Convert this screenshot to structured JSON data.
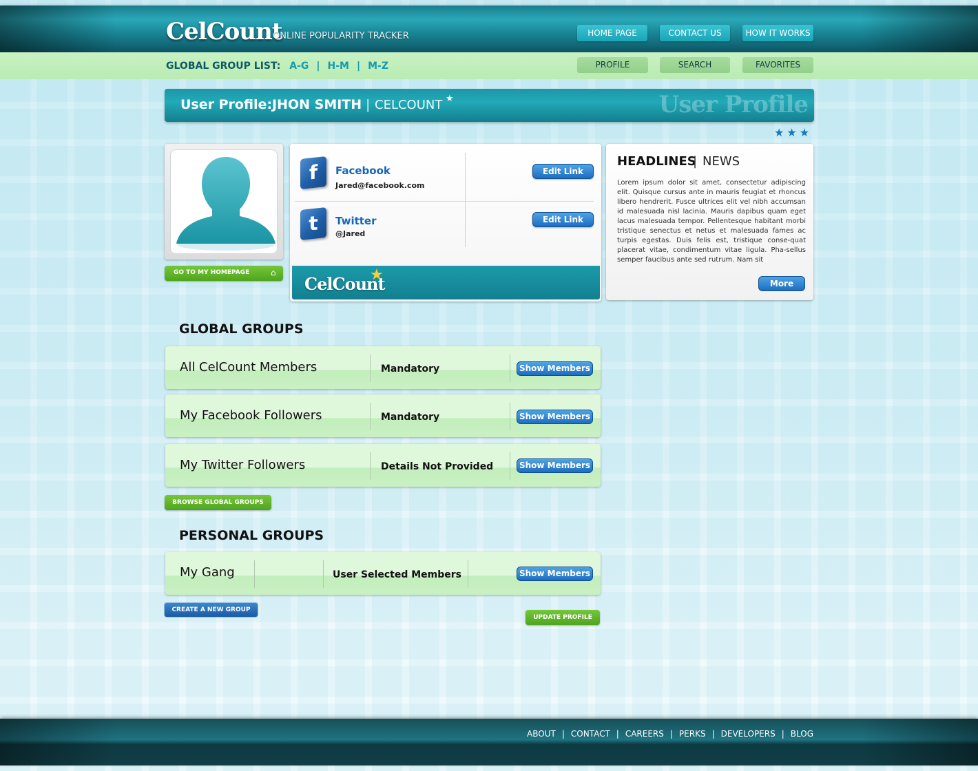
{
  "header": {
    "logo": "CelCount",
    "tagline": "ONLINE POPULARITY TRACKER",
    "nav": [
      "HOME PAGE",
      "CONTACT US",
      "HOW IT WORKS"
    ]
  },
  "subbar": {
    "group_list_label": "GLOBAL GROUP LIST:",
    "group_links": [
      "A-G",
      "H-M",
      "M-Z"
    ],
    "separator": "|",
    "nav": [
      "PROFILE",
      "SEARCH",
      "FAVORITES"
    ]
  },
  "banner": {
    "label": "User Profile:",
    "name": "JHON SMITH",
    "separator": "|",
    "brand": "CELCOUNT",
    "star": "★",
    "watermark": "User Profile",
    "rating_stars": "★★★"
  },
  "profile": {
    "homepage_button": "GO TO MY HOMEPAGE",
    "home_icon_glyph": "⌂"
  },
  "social": {
    "items": [
      {
        "network": "Facebook",
        "handle": "Jared@facebook.com",
        "icon": "facebook-icon",
        "icon_glyph": "f",
        "edit_label": "Edit Link"
      },
      {
        "network": "Twitter",
        "handle": "@Jared",
        "icon": "twitter-icon",
        "icon_glyph": "t",
        "edit_label": "Edit Link"
      }
    ],
    "footer_logo": "CelCount",
    "footer_star": "★"
  },
  "news": {
    "heading": "HEADLINES",
    "separator": "|",
    "subheading": "NEWS",
    "body": "Lorem ipsum dolor sit amet, consectetur adipiscing elit. Quisque cursus ante in mauris feugiat et rhoncus libero hendrerit. Fusce ultrices elit vel nibh accumsan id malesuada nisl lacinia. Mauris dapibus quam eget lacus malesuada tempor. Pellentesque habitant morbi tristique senectus et netus et malesuada fames ac turpis egestas. Duis felis est, tristique conse-quat placerat vitae, condimentum vitae ligula. Pha-sellus semper faucibus ante sed rutrum. Nam sit",
    "more_label": "More"
  },
  "global_groups": {
    "title": "GLOBAL GROUPS",
    "rows": [
      {
        "name": "All CelCount Members",
        "status": "Mandatory",
        "button": "Show Members"
      },
      {
        "name": "My Facebook Followers",
        "status": "Mandatory",
        "button": "Show Members"
      },
      {
        "name": "My Twitter Followers",
        "status": "Details Not Provided",
        "button": "Show Members"
      }
    ],
    "browse_button": "BROWSE GLOBAL GROUPS"
  },
  "personal_groups": {
    "title": "PERSONAL GROUPS",
    "rows": [
      {
        "name": "My Gang",
        "status": "User Selected Members",
        "button": "Show Members"
      }
    ],
    "create_button": "CREATE A NEW GROUP",
    "update_button": "UPDATE PROFILE"
  },
  "footer": {
    "links": [
      "ABOUT",
      "CONTACT",
      "CAREERS",
      "PERKS",
      "DEVELOPERS",
      "BLOG"
    ],
    "separator": "|"
  },
  "colors": {
    "header_teal": "#1b8a9a",
    "subbar_green": "#c9f2c4",
    "button_blue": "#1d6dc0",
    "button_green": "#4ea51d",
    "star_blue": "#1478c4"
  }
}
